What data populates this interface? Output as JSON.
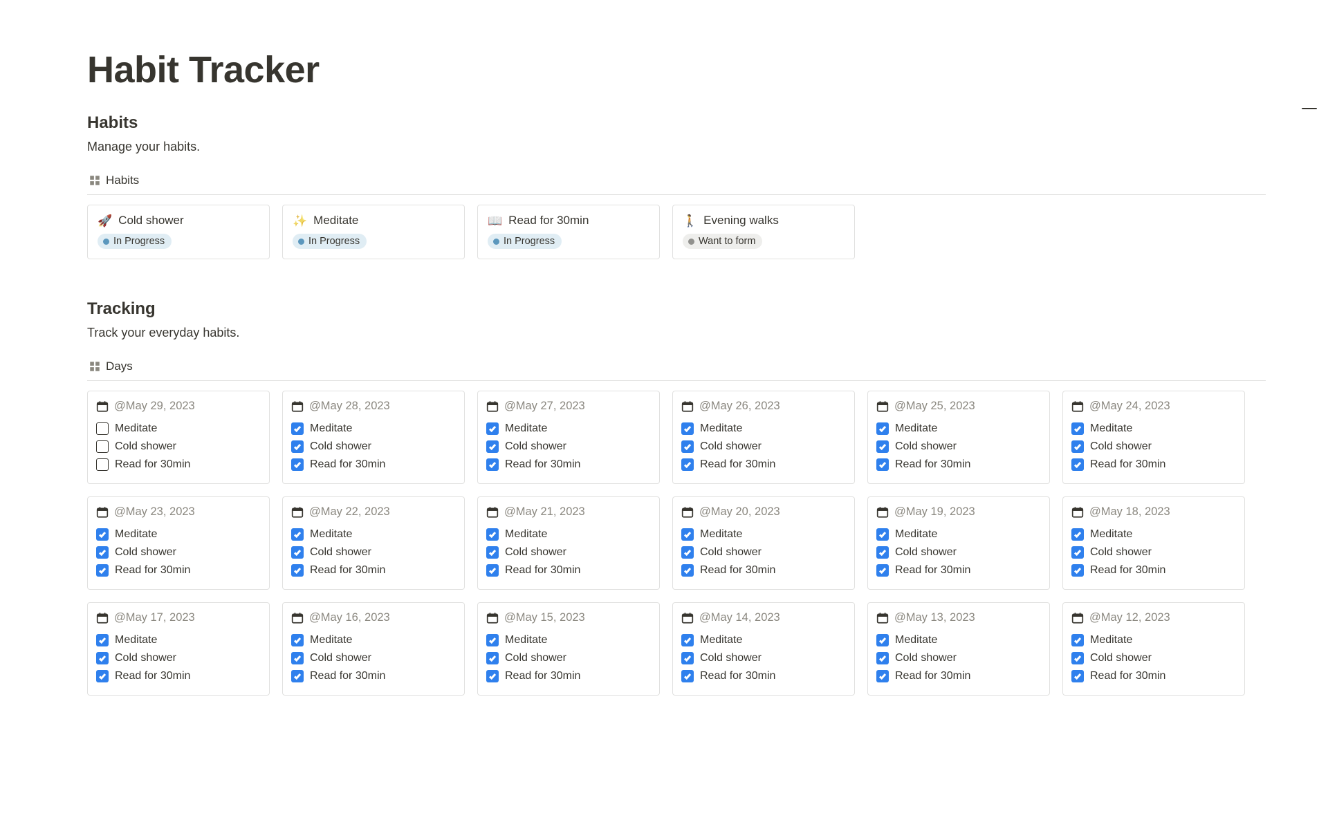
{
  "page_title": "Habit Tracker",
  "habits_section": {
    "title": "Habits",
    "desc": "Manage your habits.",
    "tab_label": "Habits",
    "cards": [
      {
        "emoji": "🚀",
        "name": "Cold shower",
        "status": "In Progress",
        "status_kind": "blue"
      },
      {
        "emoji": "✨",
        "name": "Meditate",
        "status": "In Progress",
        "status_kind": "blue"
      },
      {
        "emoji": "📖",
        "name": "Read for 30min",
        "status": "In Progress",
        "status_kind": "blue"
      },
      {
        "emoji": "🚶",
        "name": "Evening walks",
        "status": "Want to form",
        "status_kind": "gray"
      }
    ]
  },
  "tracking_section": {
    "title": "Tracking",
    "desc": "Track your everyday habits.",
    "tab_label": "Days",
    "task_labels": [
      "Meditate",
      "Cold shower",
      "Read for 30min"
    ],
    "days": [
      {
        "date": "@May 29, 2023",
        "checks": [
          false,
          false,
          false
        ]
      },
      {
        "date": "@May 28, 2023",
        "checks": [
          true,
          true,
          true
        ]
      },
      {
        "date": "@May 27, 2023",
        "checks": [
          true,
          true,
          true
        ]
      },
      {
        "date": "@May 26, 2023",
        "checks": [
          true,
          true,
          true
        ]
      },
      {
        "date": "@May 25, 2023",
        "checks": [
          true,
          true,
          true
        ]
      },
      {
        "date": "@May 24, 2023",
        "checks": [
          true,
          true,
          true
        ]
      },
      {
        "date": "@May 23, 2023",
        "checks": [
          true,
          true,
          true
        ]
      },
      {
        "date": "@May 22, 2023",
        "checks": [
          true,
          true,
          true
        ]
      },
      {
        "date": "@May 21, 2023",
        "checks": [
          true,
          true,
          true
        ]
      },
      {
        "date": "@May 20, 2023",
        "checks": [
          true,
          true,
          true
        ]
      },
      {
        "date": "@May 19, 2023",
        "checks": [
          true,
          true,
          true
        ]
      },
      {
        "date": "@May 18, 2023",
        "checks": [
          true,
          true,
          true
        ]
      },
      {
        "date": "@May 17, 2023",
        "checks": [
          true,
          true,
          true
        ]
      },
      {
        "date": "@May 16, 2023",
        "checks": [
          true,
          true,
          true
        ]
      },
      {
        "date": "@May 15, 2023",
        "checks": [
          true,
          true,
          true
        ]
      },
      {
        "date": "@May 14, 2023",
        "checks": [
          true,
          true,
          true
        ]
      },
      {
        "date": "@May 13, 2023",
        "checks": [
          true,
          true,
          true
        ]
      },
      {
        "date": "@May 12, 2023",
        "checks": [
          true,
          true,
          true
        ]
      }
    ]
  }
}
